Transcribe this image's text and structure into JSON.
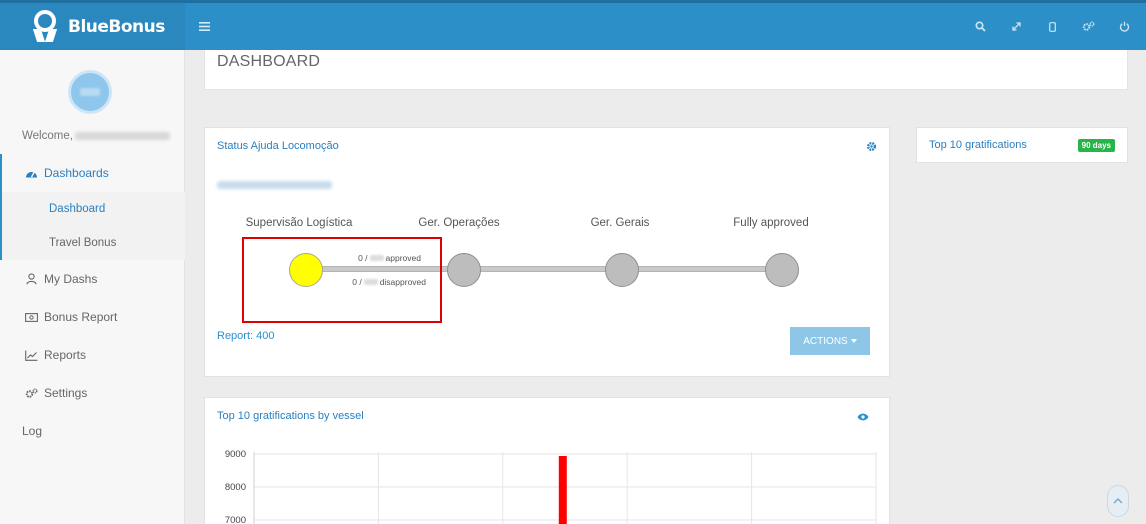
{
  "app": {
    "brand": "BlueBonus"
  },
  "topbar": {
    "menu_icon": "hamburger-icon",
    "icons": [
      "search-icon",
      "expand-icon",
      "mobile-icon",
      "cogs-icon",
      "power-icon"
    ]
  },
  "sidebar": {
    "welcome_label": "Welcome,",
    "items": [
      {
        "label": "Dashboards",
        "icon": "tachometer-icon"
      },
      {
        "label": "Dashboard"
      },
      {
        "label": "Travel Bonus"
      },
      {
        "label": "My Dashs",
        "icon": "user-icon"
      },
      {
        "label": "Bonus Report",
        "icon": "money-icon"
      },
      {
        "label": "Reports",
        "icon": "line-chart-icon"
      },
      {
        "label": "Settings",
        "icon": "cogs-icon"
      },
      {
        "label": "Log"
      }
    ]
  },
  "page": {
    "title": "DASHBOARD"
  },
  "status_panel": {
    "title": "Status Ajuda Locomoção",
    "stages": [
      "Supervisão Logística",
      "Ger. Operações",
      "Ger. Gerais",
      "Fully approved"
    ],
    "current_stage": "Supervisão Logística",
    "approved": {
      "prefix": "0 /",
      "suffix": "approved"
    },
    "disapproved": {
      "prefix": "0 /",
      "suffix": "disapproved"
    },
    "report": "Report: 400",
    "actions_label": "ACTIONS"
  },
  "top10_panel": {
    "title": "Top 10 gratifications",
    "badge": "90 days"
  },
  "vessel_panel": {
    "title": "Top 10 gratifications by vessel"
  },
  "chart_data": {
    "type": "bar",
    "title": "Top 10 gratifications by vessel",
    "ytick_labels": [
      "9000",
      "8000",
      "7000"
    ],
    "ylim_visible": [
      7000,
      9000
    ],
    "bar_above_visible_top": true,
    "grid": true
  },
  "colors": {
    "topbar": "#2d8fc8",
    "accent": "#2a7fc0",
    "current_stage": "#ffff00",
    "pending_stage": "#bdbdbd",
    "highlight": "#e10000",
    "badge": "#27b54a",
    "bar": "#ff0000"
  }
}
